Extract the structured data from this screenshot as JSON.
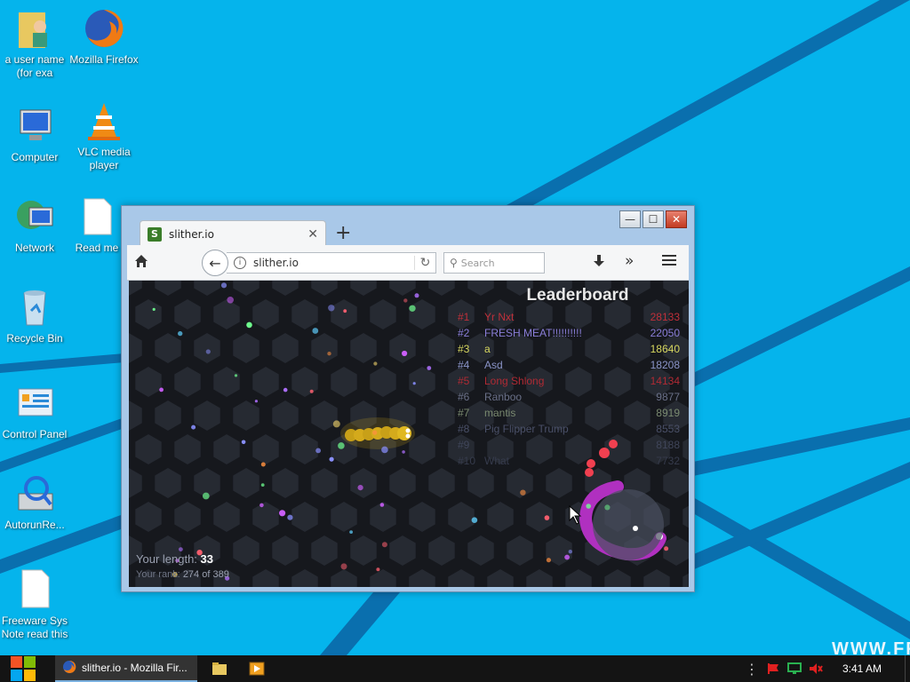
{
  "desktop": {
    "icons": [
      {
        "label": "a user name (for exa",
        "icon": "user-folder-icon"
      },
      {
        "label": "Mozilla Firefox",
        "icon": "firefox-icon"
      },
      {
        "label": "Computer",
        "icon": "computer-icon"
      },
      {
        "label": "VLC media player",
        "icon": "vlc-icon"
      },
      {
        "label": "Network",
        "icon": "network-icon"
      },
      {
        "label": "Read me",
        "icon": "document-icon"
      },
      {
        "label": "Recycle Bin",
        "icon": "recycle-bin-icon"
      },
      {
        "label": "Control Panel",
        "icon": "control-panel-icon"
      },
      {
        "label": "AutorunRe...",
        "icon": "autorun-icon"
      },
      {
        "label": "Freeware Sys Note read this",
        "icon": "document-icon"
      }
    ],
    "watermark": "WWW.FR"
  },
  "browser": {
    "tab_title": "slither.io",
    "tab_favicon": "S",
    "url": "slither.io",
    "search_placeholder": "Search",
    "controls": {
      "minimize": "—",
      "maximize": "☐",
      "close": "✕"
    }
  },
  "game": {
    "leaderboard_title": "Leaderboard",
    "leaderboard": [
      {
        "rank": "#1",
        "name": "Yr Nxt",
        "score": "28133",
        "color": "#c0303a"
      },
      {
        "rank": "#2",
        "name": "FRESH MEAT!!!!!!!!!!",
        "score": "22050",
        "color": "#8a7ed8"
      },
      {
        "rank": "#3",
        "name": "a",
        "score": "18640",
        "color": "#d8d860"
      },
      {
        "rank": "#4",
        "name": "Asd",
        "score": "18208",
        "color": "#8a94c8"
      },
      {
        "rank": "#5",
        "name": "Long Shlong",
        "score": "14134",
        "color": "#b02a34"
      },
      {
        "rank": "#6",
        "name": "Ranboo",
        "score": "9877",
        "color": "#6a7088"
      },
      {
        "rank": "#7",
        "name": "mantis",
        "score": "8919",
        "color": "#7a8a70"
      },
      {
        "rank": "#8",
        "name": "Pig Flipper Trump",
        "score": "8553",
        "color": "#4a5068"
      },
      {
        "rank": "#9",
        "name": "",
        "score": "8188",
        "color": "#40465a"
      },
      {
        "rank": "#10",
        "name": "What",
        "score": "7732",
        "color": "#363b4c"
      }
    ],
    "length_label": "Your length:",
    "length_value": "33",
    "rank_label": "Your rank:",
    "rank_value": "274",
    "rank_of": "of 389"
  },
  "taskbar": {
    "active_item": "slither.io - Mozilla Fir...",
    "clock": "3:41 AM"
  },
  "colors": {
    "desktop": "#05b4ec",
    "taskbar": "#141414",
    "snake_yellow": "#e0b820",
    "snake_purple": "#b030c0"
  }
}
